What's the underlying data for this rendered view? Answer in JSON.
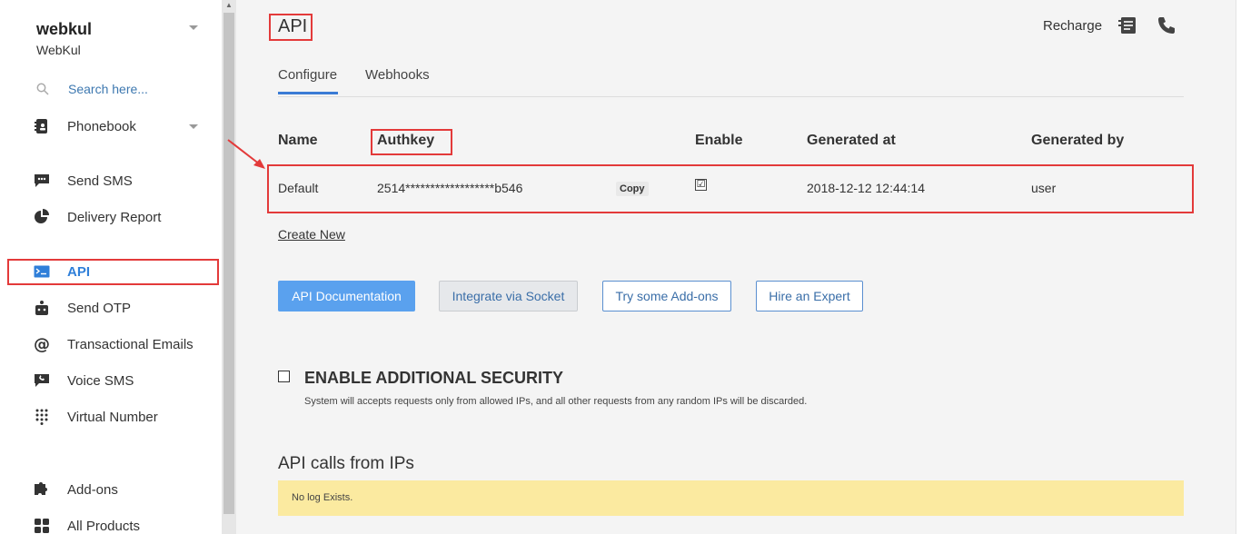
{
  "sidebar": {
    "brand": "webkul",
    "brand_sub": "WebKul",
    "search_placeholder": "Search here...",
    "items": [
      {
        "label": "Phonebook"
      },
      {
        "label": "Send SMS"
      },
      {
        "label": "Delivery Report"
      },
      {
        "label": "API"
      },
      {
        "label": "Send OTP"
      },
      {
        "label": "Transactional Emails"
      },
      {
        "label": "Voice SMS"
      },
      {
        "label": "Virtual Number"
      },
      {
        "label": "Add-ons"
      },
      {
        "label": "All Products"
      }
    ]
  },
  "header": {
    "title": "API",
    "recharge": "Recharge"
  },
  "tabs": [
    {
      "label": "Configure"
    },
    {
      "label": "Webhooks"
    }
  ],
  "table": {
    "headers": [
      "Name",
      "Authkey",
      "Enable",
      "Generated at",
      "Generated by"
    ],
    "row": {
      "name": "Default",
      "authkey": "2514******************b546",
      "copy": "Copy",
      "enabled": "☑",
      "generated_at": "2018-12-12 12:44:14",
      "generated_by": "user"
    }
  },
  "create_new": "Create New",
  "buttons": {
    "api_docs": "API Documentation",
    "socket": "Integrate via Socket",
    "addons": "Try some Add-ons",
    "expert": "Hire an Expert"
  },
  "security": {
    "title": "ENABLE ADDITIONAL SECURITY",
    "desc": "System will accepts requests only from allowed IPs, and all other requests from any random IPs will be discarded."
  },
  "ips": {
    "title": "API calls from IPs",
    "empty": "No log Exists."
  },
  "colors": {
    "accent": "#3a7bd5",
    "highlight": "#e33a3a",
    "log_bg": "#fbeaa0"
  }
}
